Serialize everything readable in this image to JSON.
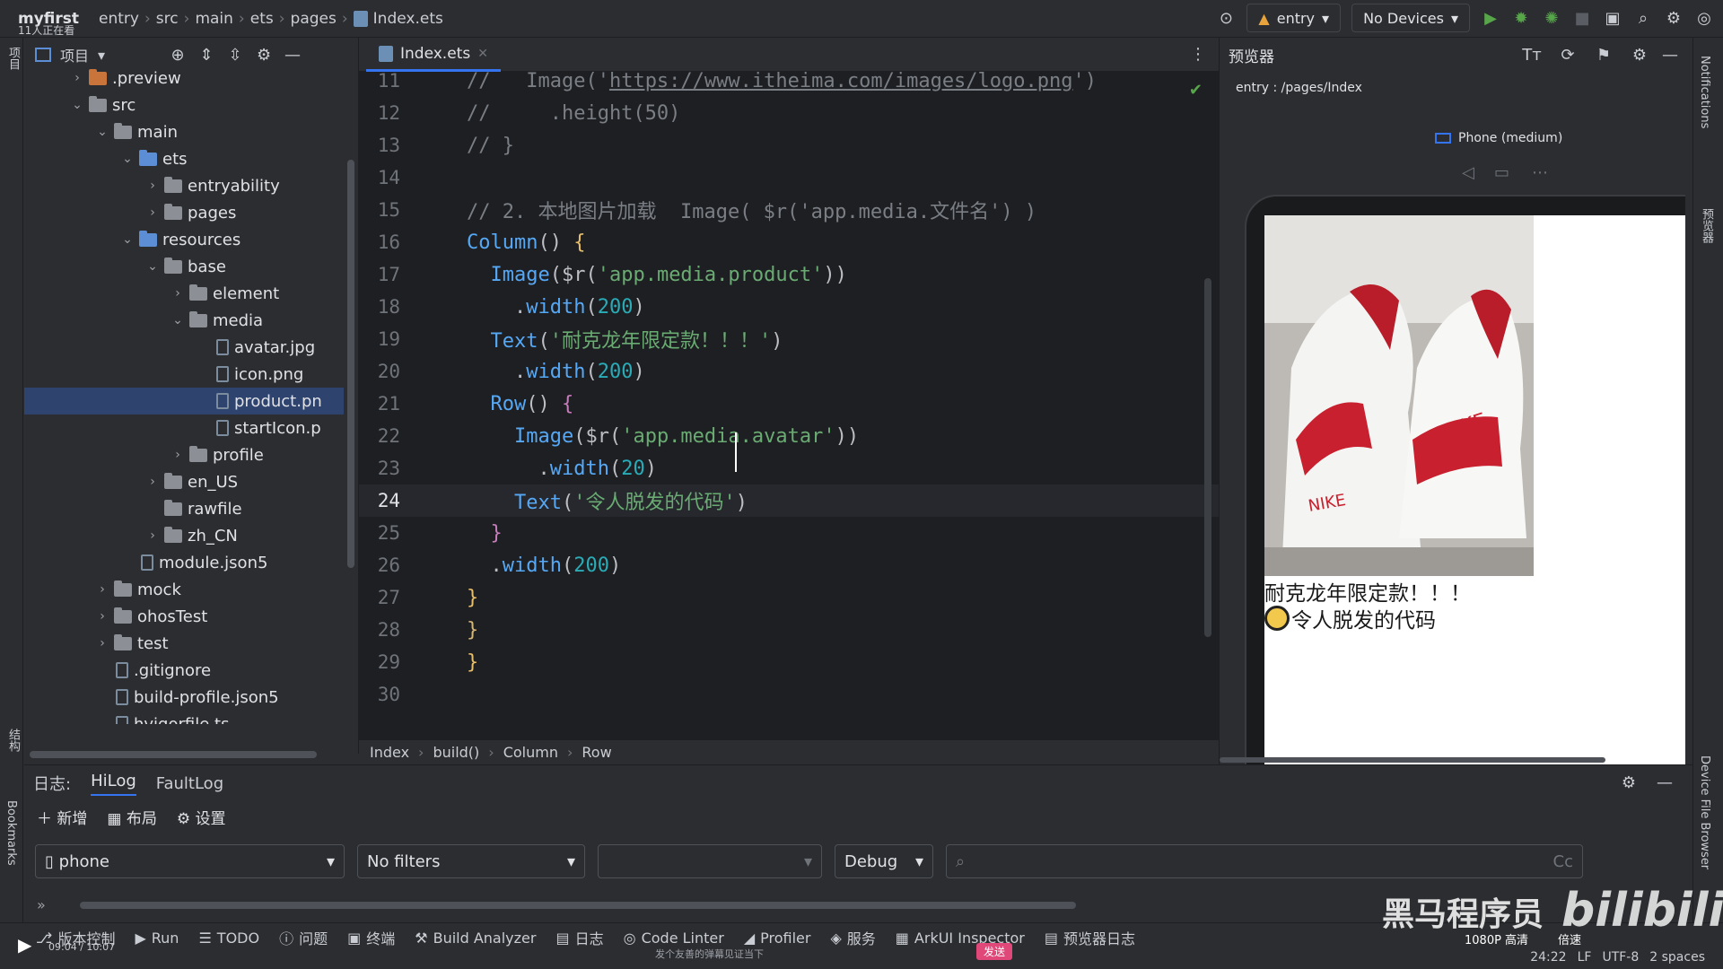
{
  "topbar": {
    "project": "myfirst",
    "project_sub": "11人正在看",
    "breadcrumbs": [
      "entry",
      "src",
      "main",
      "ets",
      "pages",
      "Index.ets"
    ],
    "run_config": "entry",
    "device": "No Devices"
  },
  "project_panel": {
    "title": "项目",
    "tree": [
      {
        "label": ".preview",
        "depth": 2,
        "type": "folder-orange",
        "chevron": "right"
      },
      {
        "label": "src",
        "depth": 2,
        "type": "folder",
        "chevron": "down"
      },
      {
        "label": "main",
        "depth": 3,
        "type": "folder",
        "chevron": "down"
      },
      {
        "label": "ets",
        "depth": 4,
        "type": "folder-blue",
        "chevron": "down"
      },
      {
        "label": "entryability",
        "depth": 5,
        "type": "folder",
        "chevron": "right"
      },
      {
        "label": "pages",
        "depth": 5,
        "type": "folder",
        "chevron": "right"
      },
      {
        "label": "resources",
        "depth": 4,
        "type": "folder-blue",
        "chevron": "down"
      },
      {
        "label": "base",
        "depth": 5,
        "type": "folder",
        "chevron": "down"
      },
      {
        "label": "element",
        "depth": 6,
        "type": "folder",
        "chevron": "right"
      },
      {
        "label": "media",
        "depth": 6,
        "type": "folder",
        "chevron": "down"
      },
      {
        "label": "avatar.jpg",
        "depth": 7,
        "type": "file",
        "chevron": ""
      },
      {
        "label": "icon.png",
        "depth": 7,
        "type": "file",
        "chevron": ""
      },
      {
        "label": "product.pn",
        "depth": 7,
        "type": "file",
        "chevron": "",
        "selected": true
      },
      {
        "label": "startIcon.p",
        "depth": 7,
        "type": "file",
        "chevron": ""
      },
      {
        "label": "profile",
        "depth": 6,
        "type": "folder",
        "chevron": "right"
      },
      {
        "label": "en_US",
        "depth": 5,
        "type": "folder",
        "chevron": "right"
      },
      {
        "label": "rawfile",
        "depth": 5,
        "type": "folder",
        "chevron": ""
      },
      {
        "label": "zh_CN",
        "depth": 5,
        "type": "folder",
        "chevron": "right"
      },
      {
        "label": "module.json5",
        "depth": 4,
        "type": "file",
        "chevron": ""
      },
      {
        "label": "mock",
        "depth": 3,
        "type": "folder",
        "chevron": "right"
      },
      {
        "label": "ohosTest",
        "depth": 3,
        "type": "folder",
        "chevron": "right"
      },
      {
        "label": "test",
        "depth": 3,
        "type": "folder",
        "chevron": "right"
      },
      {
        "label": ".gitignore",
        "depth": 3,
        "type": "file",
        "chevron": ""
      },
      {
        "label": "build-profile.json5",
        "depth": 3,
        "type": "file",
        "chevron": ""
      },
      {
        "label": "hvigorfile.ts",
        "depth": 3,
        "type": "file",
        "chevron": ""
      }
    ]
  },
  "editor": {
    "tab": "Index.ets",
    "current_line": 24,
    "lines": [
      {
        "n": 11,
        "code": [
          [
            "cm",
            "//   Image('"
          ],
          [
            "cm underline",
            "https://www.itheima.com/images/logo.png"
          ],
          [
            "cm",
            "')"
          ]
        ]
      },
      {
        "n": 12,
        "code": [
          [
            "cm",
            "//     .height(50)"
          ]
        ]
      },
      {
        "n": 13,
        "code": [
          [
            "cm",
            "// }"
          ]
        ]
      },
      {
        "n": 14,
        "code": []
      },
      {
        "n": 15,
        "code": [
          [
            "cm",
            "// 2. 本地图片加载  Image( $r('app.media.文件名') )"
          ]
        ]
      },
      {
        "n": 16,
        "code": [
          [
            "fn",
            "Column"
          ],
          [
            "plain",
            "() "
          ],
          [
            "br1",
            "{"
          ]
        ]
      },
      {
        "n": 17,
        "code": [
          [
            "plain",
            "  "
          ],
          [
            "fn",
            "Image"
          ],
          [
            "plain",
            "($r("
          ],
          [
            "str",
            "'app.media.product'"
          ],
          [
            "plain",
            "))"
          ]
        ]
      },
      {
        "n": 18,
        "code": [
          [
            "plain",
            "    ."
          ],
          [
            "fn",
            "width"
          ],
          [
            "plain",
            "("
          ],
          [
            "num",
            "200"
          ],
          [
            "plain",
            ")"
          ]
        ]
      },
      {
        "n": 19,
        "code": [
          [
            "plain",
            "  "
          ],
          [
            "fn",
            "Text"
          ],
          [
            "plain",
            "("
          ],
          [
            "str",
            "'耐克龙年限定款！！！'"
          ],
          [
            "plain",
            ")"
          ]
        ]
      },
      {
        "n": 20,
        "code": [
          [
            "plain",
            "    ."
          ],
          [
            "fn",
            "width"
          ],
          [
            "plain",
            "("
          ],
          [
            "num",
            "200"
          ],
          [
            "plain",
            ")"
          ]
        ]
      },
      {
        "n": 21,
        "code": [
          [
            "plain",
            "  "
          ],
          [
            "fn",
            "Row"
          ],
          [
            "plain",
            "() "
          ],
          [
            "br2",
            "{"
          ]
        ]
      },
      {
        "n": 22,
        "code": [
          [
            "plain",
            "    "
          ],
          [
            "fn",
            "Image"
          ],
          [
            "plain",
            "($r("
          ],
          [
            "str",
            "'app.media.avatar'"
          ],
          [
            "plain",
            "))"
          ]
        ]
      },
      {
        "n": 23,
        "code": [
          [
            "plain",
            "      ."
          ],
          [
            "fn",
            "width"
          ],
          [
            "plain",
            "("
          ],
          [
            "num",
            "20"
          ],
          [
            "plain",
            ")"
          ]
        ]
      },
      {
        "n": 24,
        "code": [
          [
            "plain",
            "    "
          ],
          [
            "fn",
            "Text"
          ],
          [
            "plain",
            "("
          ],
          [
            "str",
            "'令人脱发的代码'"
          ],
          [
            "plain",
            ")"
          ]
        ]
      },
      {
        "n": 25,
        "code": [
          [
            "plain",
            "  "
          ],
          [
            "br2",
            "}"
          ]
        ]
      },
      {
        "n": 26,
        "code": [
          [
            "plain",
            "  ."
          ],
          [
            "fn",
            "width"
          ],
          [
            "plain",
            "("
          ],
          [
            "num",
            "200"
          ],
          [
            "plain",
            ")"
          ]
        ]
      },
      {
        "n": 27,
        "code": [
          [
            "br1",
            "}"
          ]
        ]
      },
      {
        "n": 28,
        "code": [
          [
            "brgold",
            "}"
          ]
        ]
      },
      {
        "n": 29,
        "code": [
          [
            "br1",
            "}"
          ]
        ]
      },
      {
        "n": 30,
        "code": []
      }
    ],
    "breadcrumb": [
      "Index",
      "build()",
      "Column",
      "Row"
    ]
  },
  "preview": {
    "title": "预览器",
    "path": "entry : /pages/Index",
    "device": "Phone (medium)",
    "text1": "耐克龙年限定款！！！",
    "text2": "令人脱发的代码"
  },
  "log": {
    "label": "日志:",
    "tabs": [
      "HiLog",
      "FaultLog"
    ],
    "actions": [
      "新增",
      "布局",
      "设置"
    ],
    "device_filter": "phone",
    "filter": "No filters",
    "level": "Debug",
    "cc": "Cc"
  },
  "bottom": {
    "tools": [
      "版本控制",
      "Run",
      "TODO",
      "问题",
      "终端",
      "Build Analyzer",
      "日志",
      "Code Linter",
      "Profiler",
      "服务",
      "ArkUI Inspector",
      "预览器日志"
    ],
    "status": [
      "24:22",
      "LF",
      "UTF-8",
      "2 spaces"
    ],
    "video_time": "09:04 / 10:07",
    "danmaku_hint": "发个友善的弹幕见证当下",
    "send": "发送",
    "quality": "1080P 高清",
    "speed": "倍速"
  },
  "side_labels": {
    "left_top": "项目",
    "left_mid": "结构",
    "left_bottom": "Bookmarks",
    "right_top": "Notifications",
    "right_mid": "预览器",
    "right_bottom": "Device File Browser"
  },
  "watermark": {
    "brand": "黑马程序员",
    "site": "bilibili"
  },
  "colors": {
    "accent": "#3574f0",
    "selection": "#2e436e",
    "editor_bg": "#1e1f22",
    "panel_bg": "#2b2d30"
  }
}
